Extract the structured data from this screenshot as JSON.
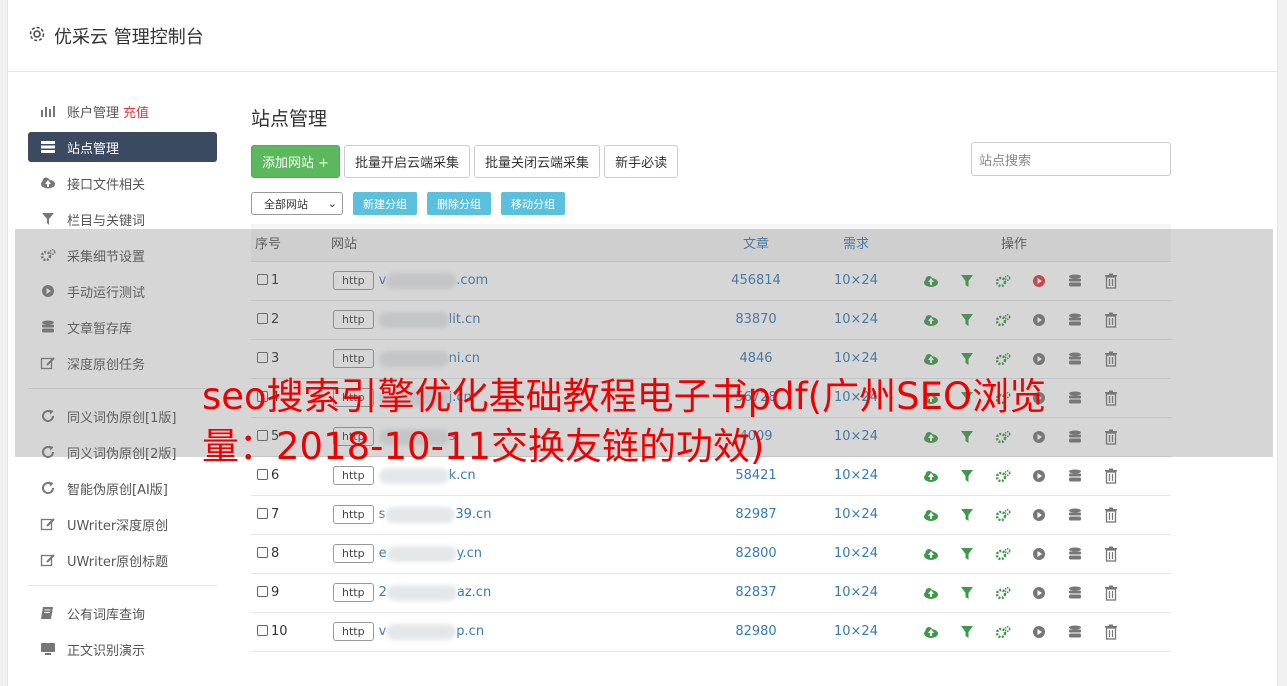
{
  "app": {
    "title": "优采云 管理控制台"
  },
  "sidebar": {
    "items": [
      {
        "label": "账户管理",
        "badge": "充值",
        "icon": "bar-chart-icon"
      },
      {
        "label": "站点管理",
        "icon": "server-icon",
        "active": true
      },
      {
        "label": "接口文件相关",
        "icon": "cloud-upload-icon"
      },
      {
        "label": "栏目与关键词",
        "icon": "filter-icon"
      },
      {
        "label": "采集细节设置",
        "icon": "gears-icon"
      },
      {
        "label": "手动运行测试",
        "icon": "play-circle-icon"
      },
      {
        "label": "文章暂存库",
        "icon": "database-icon"
      },
      {
        "label": "深度原创任务",
        "icon": "edit-icon"
      },
      {
        "label": "同义词伪原创[1版]",
        "icon": "refresh-icon"
      },
      {
        "label": "同义词伪原创[2版]",
        "icon": "refresh-icon"
      },
      {
        "label": "智能伪原创[AI版]",
        "icon": "refresh-icon"
      },
      {
        "label": "UWriter深度原创",
        "icon": "edit-icon"
      },
      {
        "label": "UWriter原创标题",
        "icon": "edit-icon"
      },
      {
        "label": "公有词库查询",
        "icon": "book-icon"
      },
      {
        "label": "正文识别演示",
        "icon": "monitor-icon"
      }
    ]
  },
  "main": {
    "heading": "站点管理",
    "buttons": {
      "add": "添加网站 +",
      "batch_open": "批量开启云端采集",
      "batch_close": "批量关闭云端采集",
      "newbie": "新手必读"
    },
    "search_placeholder": "站点搜索",
    "group_select": "全部网站",
    "group_buttons": {
      "new": "新建分组",
      "delete": "删除分组",
      "move": "移动分组"
    },
    "table": {
      "headers": [
        "序号",
        "网站",
        "文章",
        "需求",
        "操作"
      ],
      "rows": [
        {
          "num": "1",
          "proto": "http",
          "d1": "v",
          "d2": ".com",
          "articles": "456814",
          "need": "10×24",
          "running": true
        },
        {
          "num": "2",
          "proto": "http",
          "d1": "",
          "d2": "lit.cn",
          "articles": "83870",
          "need": "10×24",
          "running": false
        },
        {
          "num": "3",
          "proto": "http",
          "d1": "",
          "d2": "ni.cn",
          "articles": "4846",
          "need": "10×24",
          "running": false
        },
        {
          "num": "4",
          "proto": "http",
          "d1": "",
          "d2": "j.cn",
          "articles": "56728",
          "need": "10×24",
          "running": false
        },
        {
          "num": "5",
          "proto": "http",
          "d1": "",
          "d2": "s",
          "articles": "4009",
          "need": "10×24",
          "running": false
        },
        {
          "num": "6",
          "proto": "http",
          "d1": "",
          "d2": "k.cn",
          "articles": "58421",
          "need": "10×24",
          "running": false
        },
        {
          "num": "7",
          "proto": "http",
          "d1": "s",
          "d2": "39.cn",
          "articles": "82987",
          "need": "10×24",
          "running": false
        },
        {
          "num": "8",
          "proto": "http",
          "d1": "e",
          "d2": "y.cn",
          "articles": "82800",
          "need": "10×24",
          "running": false
        },
        {
          "num": "9",
          "proto": "http",
          "d1": "2",
          "d2": "az.cn",
          "articles": "82837",
          "need": "10×24",
          "running": false
        },
        {
          "num": "10",
          "proto": "http",
          "d1": "v",
          "d2": "p.cn",
          "articles": "82980",
          "need": "10×24",
          "running": false
        }
      ]
    }
  },
  "overlay": {
    "title": "seo搜索引擎优化基础教程电子书pdf(广州SEO浏览量：2018-10-11交换友链的功效)"
  },
  "colors": {
    "green": "#5cb85c",
    "info": "#5bc0de",
    "link": "#337ab7",
    "active": "#3b4a60",
    "red": "#e4393c",
    "overlay_text": "#ee0000"
  }
}
